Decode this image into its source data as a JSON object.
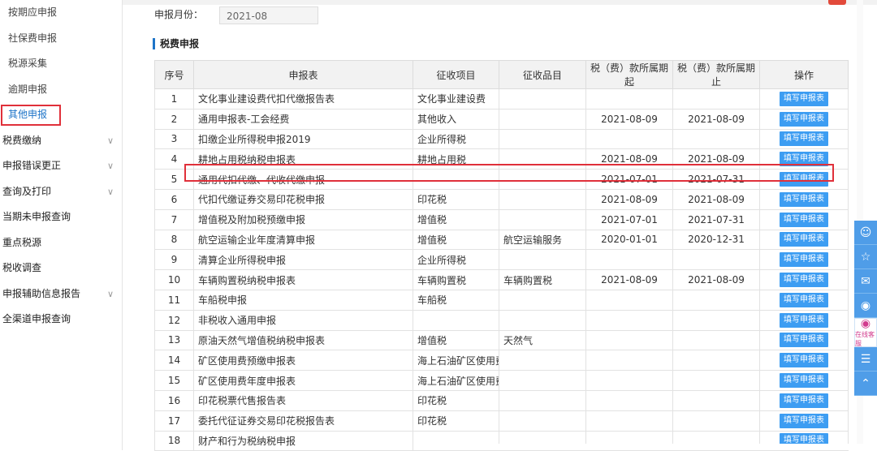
{
  "sidebar": {
    "items": [
      {
        "label": "按期应申报",
        "level": "sub",
        "active": false,
        "expandable": false
      },
      {
        "label": "社保费申报",
        "level": "sub",
        "active": false,
        "expandable": false
      },
      {
        "label": "税源采集",
        "level": "sub",
        "active": false,
        "expandable": false
      },
      {
        "label": "逾期申报",
        "level": "sub",
        "active": false,
        "expandable": false
      },
      {
        "label": "其他申报",
        "level": "sub",
        "active": true,
        "expandable": false
      },
      {
        "label": "税费缴纳",
        "level": "top",
        "active": false,
        "expandable": true
      },
      {
        "label": "申报错误更正",
        "level": "top",
        "active": false,
        "expandable": true
      },
      {
        "label": "查询及打印",
        "level": "top",
        "active": false,
        "expandable": true
      },
      {
        "label": "当期未申报查询",
        "level": "top",
        "active": false,
        "expandable": false
      },
      {
        "label": "重点税源",
        "level": "top",
        "active": false,
        "expandable": false
      },
      {
        "label": "税收调查",
        "level": "top",
        "active": false,
        "expandable": false
      },
      {
        "label": "申报辅助信息报告",
        "level": "top",
        "active": false,
        "expandable": true
      },
      {
        "label": "全渠道申报查询",
        "level": "top",
        "active": false,
        "expandable": false
      }
    ]
  },
  "month": {
    "label": "申报月份：",
    "value": "2021-08"
  },
  "section": {
    "title": "税费申报"
  },
  "table": {
    "headers": [
      "序号",
      "申报表",
      "征收项目",
      "征收品目",
      "税（费）款所属期起",
      "税（费）款所属期止",
      "操作"
    ],
    "button_label": "填写申报表",
    "rows": [
      [
        "1",
        "文化事业建设费代扣代缴报告表",
        "文化事业建设费",
        "",
        "",
        ""
      ],
      [
        "2",
        "通用申报表-工会经费",
        "其他收入",
        "",
        "2021-08-09",
        "2021-08-09"
      ],
      [
        "3",
        "扣缴企业所得税申报2019",
        "企业所得税",
        "",
        "",
        ""
      ],
      [
        "4",
        "耕地占用税纳税申报表",
        "耕地占用税",
        "",
        "2021-08-09",
        "2021-08-09"
      ],
      [
        "5",
        "通用代扣代缴、代收代缴申报",
        "",
        "",
        "2021-07-01",
        "2021-07-31"
      ],
      [
        "6",
        "代扣代缴证券交易印花税申报",
        "印花税",
        "",
        "2021-08-09",
        "2021-08-09"
      ],
      [
        "7",
        "增值税及附加税预缴申报",
        "增值税",
        "",
        "2021-07-01",
        "2021-07-31"
      ],
      [
        "8",
        "航空运输企业年度清算申报",
        "增值税",
        "航空运输服务",
        "2020-01-01",
        "2020-12-31"
      ],
      [
        "9",
        "清算企业所得税申报",
        "企业所得税",
        "",
        "",
        ""
      ],
      [
        "10",
        "车辆购置税纳税申报表",
        "车辆购置税",
        "车辆购置税",
        "2021-08-09",
        "2021-08-09"
      ],
      [
        "11",
        "车船税申报",
        "车船税",
        "",
        "",
        ""
      ],
      [
        "12",
        "非税收入通用申报",
        "",
        "",
        "",
        ""
      ],
      [
        "13",
        "原油天然气增值税纳税申报表",
        "增值税",
        "天然气",
        "",
        ""
      ],
      [
        "14",
        "矿区使用费预缴申报表",
        "海上石油矿区使用费",
        "",
        "",
        ""
      ],
      [
        "15",
        "矿区使用费年度申报表",
        "海上石油矿区使用费",
        "",
        "",
        ""
      ],
      [
        "16",
        "印花税票代售报告表",
        "印花税",
        "",
        "",
        ""
      ],
      [
        "17",
        "委托代征证券交易印花税报告表",
        "印花税",
        "",
        "",
        ""
      ],
      [
        "18",
        "财产和行为税纳税申报",
        "",
        "",
        "",
        ""
      ]
    ]
  },
  "floatbar": {
    "icons": [
      "user-icon",
      "star-icon",
      "chat-icon",
      "weibo-icon",
      "customer-service-icon",
      "document-icon",
      "arrow-up-icon"
    ],
    "service_label": "在线客服"
  },
  "colors": {
    "accent": "#3d9df2",
    "highlight": "#e0303a",
    "active_text": "#1e74c8"
  }
}
